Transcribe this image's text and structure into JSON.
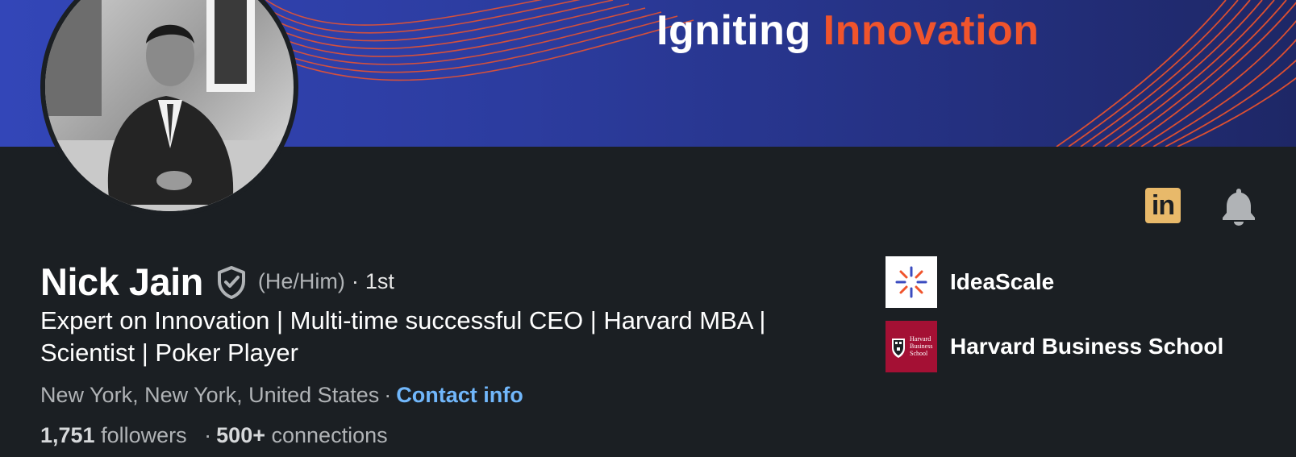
{
  "banner": {
    "title_word1": "Igniting",
    "title_word2": "Innovation",
    "accent_color": "#f0542c"
  },
  "profile": {
    "name": "Nick Jain",
    "pronouns": "(He/Him)",
    "separator": "·",
    "degree": "1st",
    "headline": "Expert on Innovation | Multi-time successful CEO | Harvard MBA | Scientist | Poker Player",
    "location": "New York, New York, United States",
    "contact_link": "Contact info",
    "followers_count": "1,751",
    "followers_label": "followers",
    "connections_count": "500+",
    "connections_label": "connections"
  },
  "actions": {
    "linkedin_icon_text": "in",
    "icons": [
      "linkedin-icon",
      "bell-icon"
    ]
  },
  "organizations": [
    {
      "name": "IdeaScale",
      "logo": "ideascale-logo"
    },
    {
      "name": "Harvard Business School",
      "logo": "hbs-logo",
      "logo_text": [
        "Harvard",
        "Business",
        "School"
      ]
    }
  ],
  "colors": {
    "background": "#1b1f23",
    "link": "#71b7fb",
    "linkedin_badge": "#e8b96a",
    "hbs_crimson": "#a41034"
  }
}
